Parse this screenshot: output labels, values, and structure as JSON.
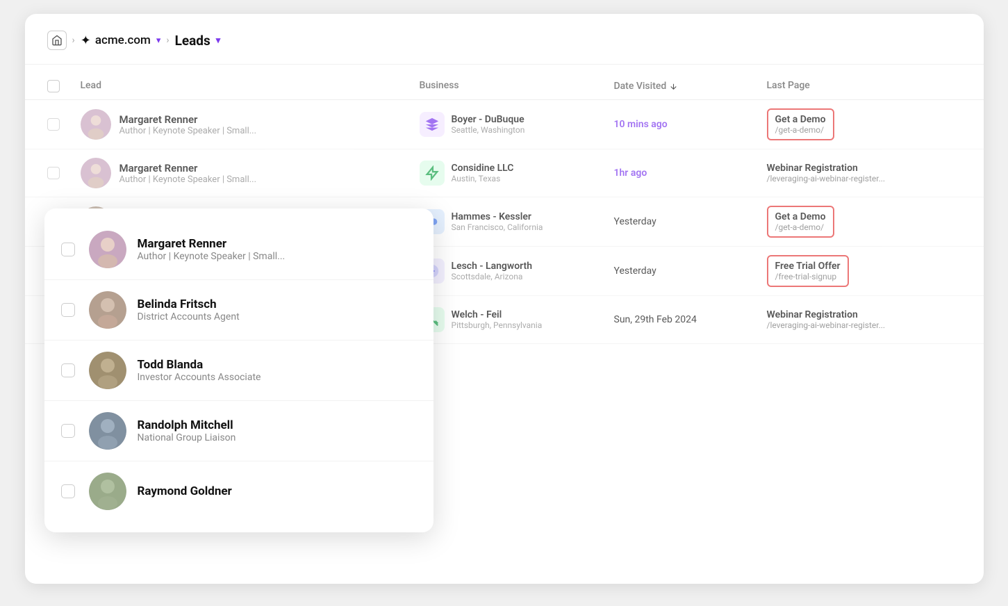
{
  "breadcrumb": {
    "home_icon": "⌂",
    "sep1": ">",
    "workspace_label": "acme.com",
    "sep2": ">",
    "page_label": "Leads"
  },
  "table": {
    "headers": {
      "lead": "Lead",
      "business": "Business",
      "date_visited": "Date Visited",
      "last_page": "Last Page"
    },
    "rows": [
      {
        "id": "margaret-renner",
        "name": "Margaret Renner",
        "role": "Author | Keynote Speaker | Small...",
        "avatar_color": "#c9a8c0",
        "business_name": "Boyer - DuBuque",
        "business_loc": "Seattle, Washington",
        "biz_color": "#7c3aed",
        "biz_icon": "🟣",
        "date": "10 mins ago",
        "date_highlight": true,
        "page_name": "Get a Demo",
        "page_url": "/get-a-demo/",
        "page_highlight": "demo"
      },
      {
        "id": "margaret-renner-2",
        "name": "Margaret Renner",
        "role": "Author | Keynote Speaker | Small...",
        "avatar_color": "#c9a8c0",
        "business_name": "Considine LLC",
        "business_loc": "Austin, Texas",
        "biz_color": "#22c55e",
        "biz_icon": "⚡",
        "date": "1hr ago",
        "date_highlight": true,
        "page_name": "Webinar Registration",
        "page_url": "/leveraging-ai-webinar-register...",
        "page_highlight": "none"
      },
      {
        "id": "belinda-fritsch",
        "name": "Belinda Fritsch",
        "role": "District Accounts Agent",
        "avatar_color": "#b5a090",
        "business_name": "Hammes - Kessler",
        "business_loc": "San Francisco, California",
        "biz_color": "#3b82f6",
        "biz_icon": "💙",
        "date": "Yesterday",
        "date_highlight": false,
        "page_name": "Get a Demo",
        "page_url": "/get-a-demo/",
        "page_highlight": "demo"
      },
      {
        "id": "todd-blanda",
        "name": "Todd Blanda",
        "role": "Investor Accounts Associate",
        "avatar_color": "#a09070",
        "business_name": "Lesch - Langworth",
        "business_loc": "Scottsdale, Arizona",
        "biz_color": "#6366f1",
        "biz_icon": "🔵",
        "date": "Yesterday",
        "date_highlight": false,
        "page_name": "Free Trial Offer",
        "page_url": "/free-trial-signup",
        "page_highlight": "trial"
      },
      {
        "id": "randolph-mitchell",
        "name": "Randolph Mitchell",
        "role": "National Group Liaison",
        "avatar_color": "#8090a0",
        "business_name": "Welch - Feil",
        "business_loc": "Pittsburgh, Pennsylvania",
        "biz_color": "#16a34a",
        "biz_icon": "📊",
        "date": "Sun, 29th Feb 2024",
        "date_highlight": false,
        "page_name": "Webinar Registration",
        "page_url": "/leveraging-ai-webinar-register...",
        "page_highlight": "none"
      }
    ]
  },
  "floating_card": {
    "items": [
      {
        "name": "Margaret Renner",
        "role": "Author | Keynote Speaker | Small...",
        "avatar_color": "#c9a8c0"
      },
      {
        "name": "Belinda Fritsch",
        "role": "District Accounts Agent",
        "avatar_color": "#b5a090"
      },
      {
        "name": "Todd Blanda",
        "role": "Investor Accounts Associate",
        "avatar_color": "#a09070"
      },
      {
        "name": "Randolph Mitchell",
        "role": "National Group Liaison",
        "avatar_color": "#8090a0"
      },
      {
        "name": "Raymond Goldner",
        "role": "",
        "avatar_color": "#9aab8a"
      }
    ]
  },
  "avatars": {
    "margaret_renner": "data:image/svg+xml,%3Csvg xmlns='http://www.w3.org/2000/svg' width='54' height='54'%3E%3Ccircle cx='27' cy='27' r='27' fill='%23c9a8c0'/%3E%3Ccircle cx='27' cy='20' r='10' fill='%23fff'/%3E%3Cellipse cx='27' cy='42' rx='15' ry='10' fill='%23fff'/%3E%3C/svg%3E",
    "belinda_fritsch": "data:image/svg+xml,%3Csvg xmlns='http://www.w3.org/2000/svg' width='54' height='54'%3E%3Ccircle cx='27' cy='27' r='27' fill='%23b5a090'/%3E%3Ccircle cx='27' cy='20' r='10' fill='%23fff'/%3E%3Cellipse cx='27' cy='42' rx='15' ry='10' fill='%23fff'/%3E%3C/svg%3E",
    "todd_blanda": "data:image/svg+xml,%3Csvg xmlns='http://www.w3.org/2000/svg' width='54' height='54'%3E%3Ccircle cx='27' cy='27' r='27' fill='%23a09070'/%3E%3Ccircle cx='27' cy='20' r='10' fill='%23fff'/%3E%3Cellipse cx='27' cy='42' rx='15' ry='10' fill='%23fff'/%3E%3C/svg%3E",
    "randolph_mitchell": "data:image/svg+xml,%3Csvg xmlns='http://www.w3.org/2000/svg' width='54' height='54'%3E%3Ccircle cx='27' cy='27' r='27' fill='%238090a0'/%3E%3Ccircle cx='27' cy='20' r='10' fill='%23fff'/%3E%3Cellipse cx='27' cy='42' rx='15' ry='10' fill='%23fff'/%3E%3C/svg%3E",
    "raymond_goldner": "data:image/svg+xml,%3Csvg xmlns='http://www.w3.org/2000/svg' width='54' height='54'%3E%3Ccircle cx='27' cy='27' r='27' fill='%239aab8a'/%3E%3Ccircle cx='27' cy='20' r='10' fill='%23fff'/%3E%3Cellipse cx='27' cy='42' rx='15' ry='10' fill='%23fff'/%3E%3C/svg%3E"
  }
}
